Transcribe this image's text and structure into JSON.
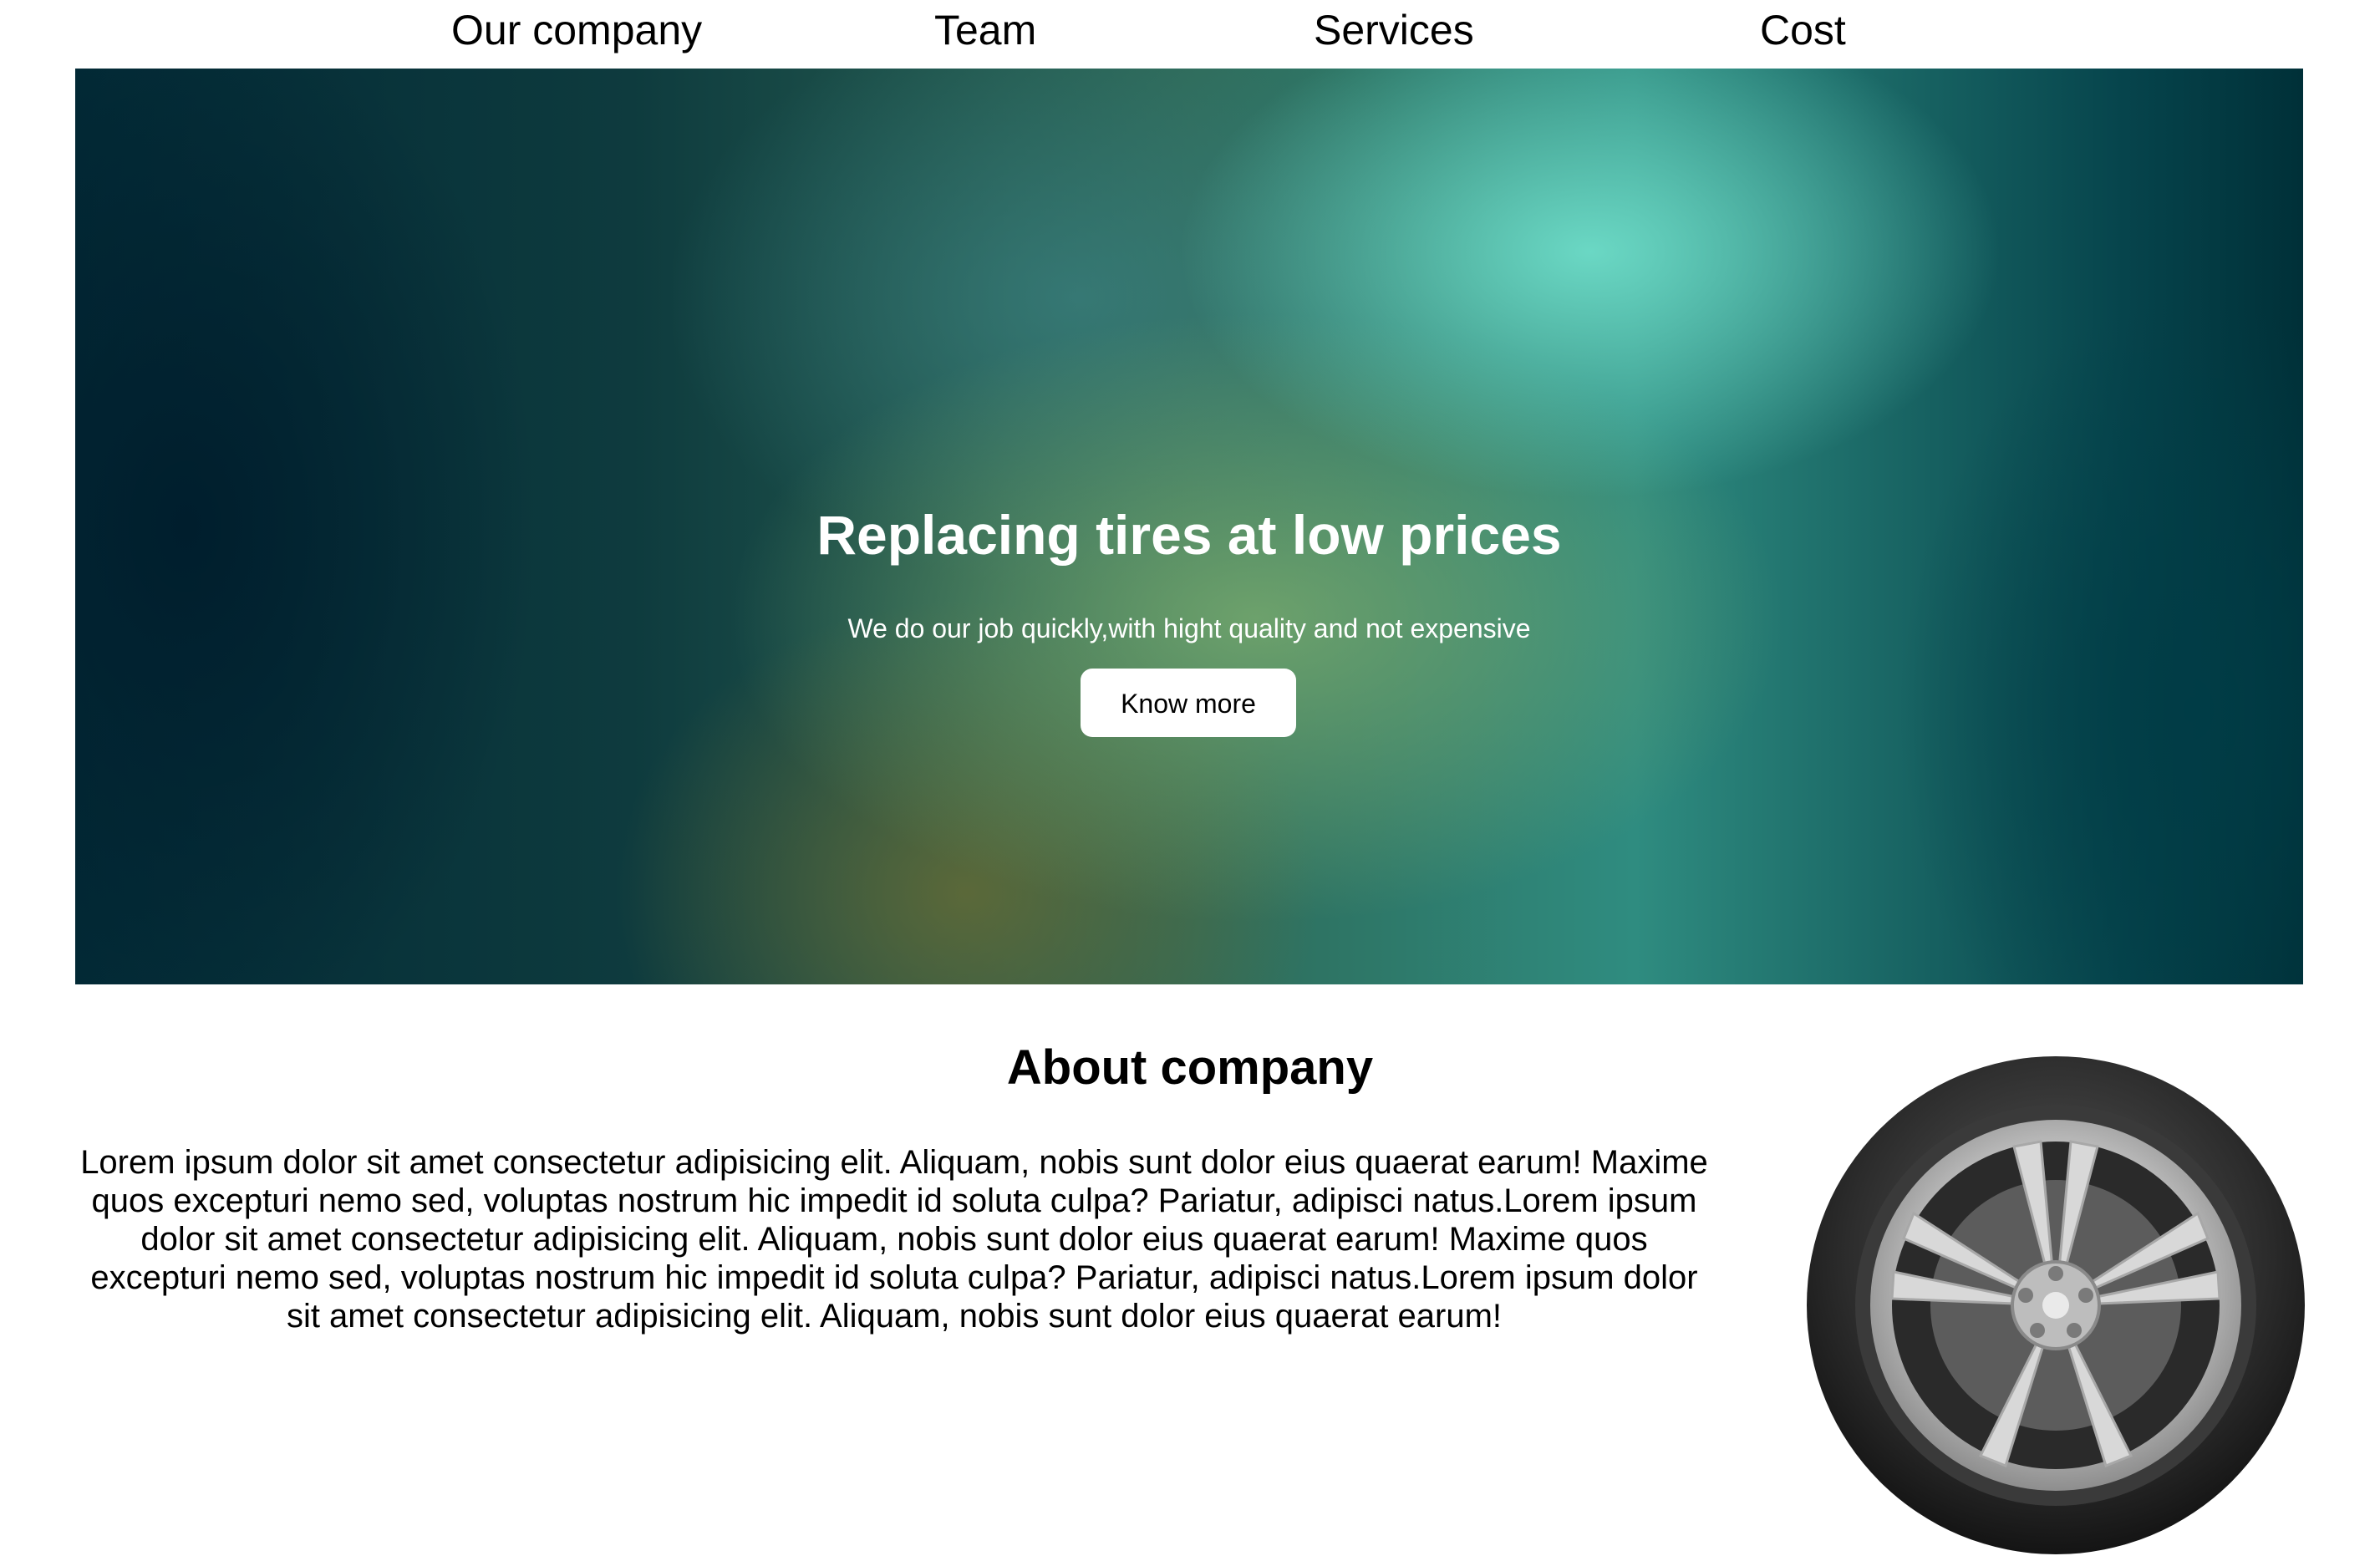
{
  "nav": {
    "items": [
      {
        "label": "Our company"
      },
      {
        "label": "Team"
      },
      {
        "label": "Services"
      },
      {
        "label": "Cost"
      }
    ]
  },
  "hero": {
    "title": "Replacing tires at low prices",
    "subtitle": "We do our job quickly,with hight quality and not expensive",
    "button_label": "Know more"
  },
  "about": {
    "title": "About company",
    "paragraph": "Lorem ipsum dolor sit amet consectetur adipisicing elit. Aliquam, nobis sunt dolor eius quaerat earum! Maxime quos excepturi nemo sed, voluptas nostrum hic impedit id soluta culpa? Pariatur, adipisci natus.Lorem ipsum dolor sit amet consectetur adipisicing elit. Aliquam, nobis sunt dolor eius quaerat earum! Maxime quos excepturi nemo sed, voluptas nostrum hic impedit id soluta culpa? Pariatur, adipisci natus.Lorem ipsum dolor sit amet consectetur adipisicing elit. Aliquam, nobis sunt dolor eius quaerat earum!"
  },
  "icons": {
    "tire": "tire-image"
  },
  "colors": {
    "hero_text": "#ffffff",
    "button_bg": "#ffffff",
    "page_bg": "#ffffff"
  }
}
